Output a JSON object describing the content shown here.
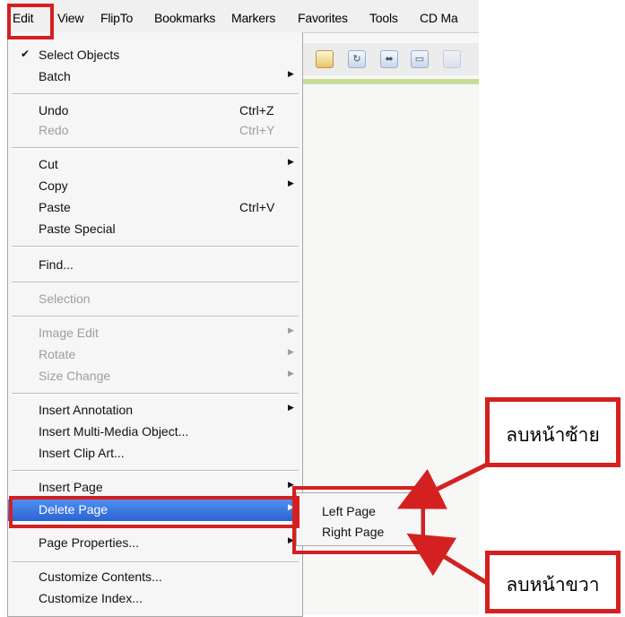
{
  "menubar": {
    "items": [
      "Edit",
      "View",
      "FlipTo",
      "Bookmarks",
      "Markers",
      "Favorites",
      "Tools",
      "CD Ma"
    ]
  },
  "toolbar": {
    "icons": [
      "book-icon",
      "refresh-icon",
      "fit-page-icon",
      "fit-width-icon",
      "thumbnail-icon"
    ]
  },
  "edit_menu": {
    "select_objects": {
      "label": "Select Objects",
      "checked": true
    },
    "batch": {
      "label": "Batch"
    },
    "undo": {
      "label": "Undo",
      "shortcut": "Ctrl+Z"
    },
    "redo": {
      "label": "Redo",
      "shortcut": "Ctrl+Y",
      "enabled": false
    },
    "cut": {
      "label": "Cut"
    },
    "copy": {
      "label": "Copy"
    },
    "paste": {
      "label": "Paste",
      "shortcut": "Ctrl+V"
    },
    "paste_special": {
      "label": "Paste Special"
    },
    "find": {
      "label": "Find..."
    },
    "selection": {
      "label": "Selection",
      "enabled": false
    },
    "image_edit": {
      "label": "Image Edit",
      "enabled": false
    },
    "rotate": {
      "label": "Rotate",
      "enabled": false
    },
    "size_change": {
      "label": "Size Change",
      "enabled": false
    },
    "insert_annotation": {
      "label": "Insert Annotation"
    },
    "insert_multimedia": {
      "label": "Insert Multi-Media Object..."
    },
    "insert_clip_art": {
      "label": "Insert Clip Art..."
    },
    "insert_page": {
      "label": "Insert Page"
    },
    "delete_page": {
      "label": "Delete Page",
      "highlighted": true
    },
    "page_properties": {
      "label": "Page Properties..."
    },
    "customize_contents": {
      "label": "Customize Contents..."
    },
    "customize_index": {
      "label": "Customize Index..."
    }
  },
  "delete_submenu": {
    "left_page": "Left Page",
    "right_page": "Right Page"
  },
  "callouts": {
    "left": "ลบหน้าซ้าย",
    "right": "ลบหน้าขวา"
  },
  "colors": {
    "highlight": "#d42020",
    "selection": "#2a64d3"
  }
}
